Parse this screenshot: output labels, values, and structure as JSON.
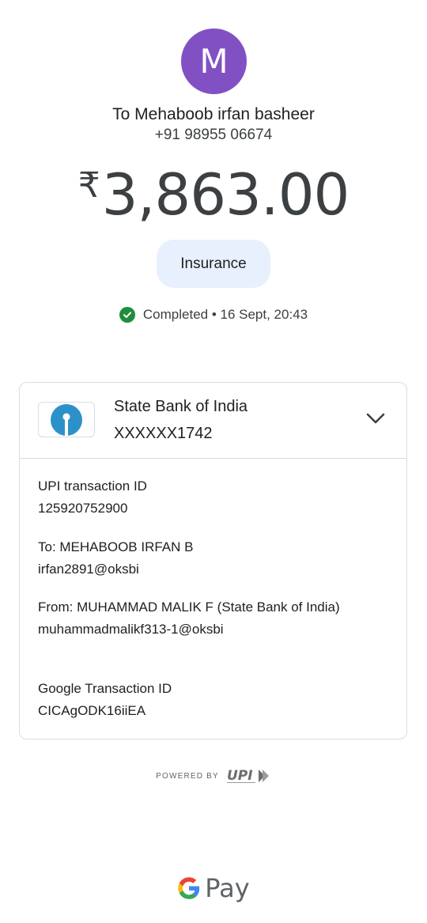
{
  "recipient": {
    "avatar_initial": "M",
    "avatar_color": "#8151c4",
    "name": "To Mehaboob irfan basheer",
    "phone": "+91 98955 06674"
  },
  "amount": {
    "currency_symbol": "₹",
    "value": "3,863.00"
  },
  "note": "Insurance",
  "status": {
    "icon": "check-circle-icon",
    "color": "#1e8e3e",
    "text": "Completed • 16 Sept, 20:43"
  },
  "bank": {
    "name": "State Bank of India",
    "account": "XXXXXX1742",
    "logo": "sbi-logo",
    "brand_color": "#2d91c9"
  },
  "details": {
    "upi_txn_label": "UPI transaction ID",
    "upi_txn_value": "125920752900",
    "to_label": "To: MEHABOOB IRFAN  B",
    "to_value": "irfan2891@oksbi",
    "from_label": "From: MUHAMMAD MALIK  F (State Bank of India)",
    "from_value": "muhammadmalikf313-1@oksbi",
    "google_txn_label": "Google Transaction ID",
    "google_txn_value": "CICAgODK16iiEA"
  },
  "footer": {
    "powered_by": "POWERED BY",
    "upi_logo": "UPI",
    "gpay_text": "Pay"
  }
}
